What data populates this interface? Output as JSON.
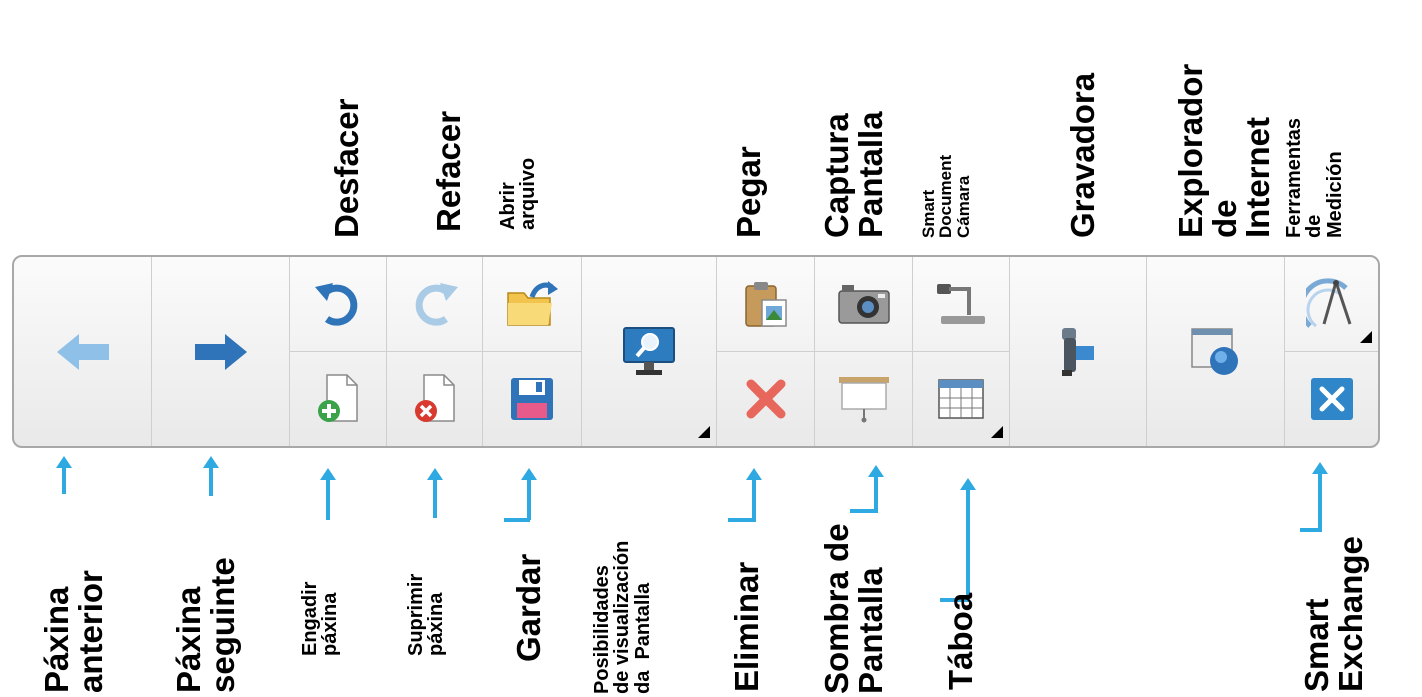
{
  "labels_top": {
    "desfacer": "Desfacer",
    "refacer": "Refacer",
    "abrir": "Abrir\narquivo",
    "pegar": "Pegar",
    "captura": "Captura\nPantalla",
    "document": "Smart\nDocument\nCámara",
    "gravadora": "Gravadora",
    "explorador": "Explorador\nde\nInternet",
    "ferramentas": "Ferramentas\nde\nMedición"
  },
  "labels_bottom": {
    "anterior": "Páxina\nanterior",
    "seguinte": "Páxina\nseguinte",
    "engadir": "Engadir\npáxina",
    "suprimir": "Suprimir\npáxina",
    "gardar": "Gardar",
    "posibilidades": "Posibilidades\nde visualización\nda  Pantalla",
    "eliminar": "Eliminar",
    "sombra": "Sombra de\nPantalla",
    "taboa": "Táboa",
    "exchange": "Smart\nExchange"
  },
  "icons": {
    "prev": "arrow-left-icon",
    "next": "arrow-right-icon",
    "undo": "undo-icon",
    "redo": "redo-icon",
    "open": "folder-open-icon",
    "add_page": "add-page-icon",
    "delete_page": "delete-page-icon",
    "save": "save-icon",
    "view": "monitor-zoom-icon",
    "paste": "paste-icon",
    "delete": "delete-x-icon",
    "screen_capture": "camera-icon",
    "screen_shade": "projection-screen-icon",
    "document_camera": "document-camera-icon",
    "table": "table-icon",
    "recorder": "video-recorder-icon",
    "browser": "internet-browser-icon",
    "measurement": "compass-icon",
    "exchange": "smart-exchange-icon"
  },
  "colors": {
    "accent_arrow": "#2fa9e2",
    "icon_blue": "#2f73b8",
    "delete_red": "#e8675c"
  }
}
